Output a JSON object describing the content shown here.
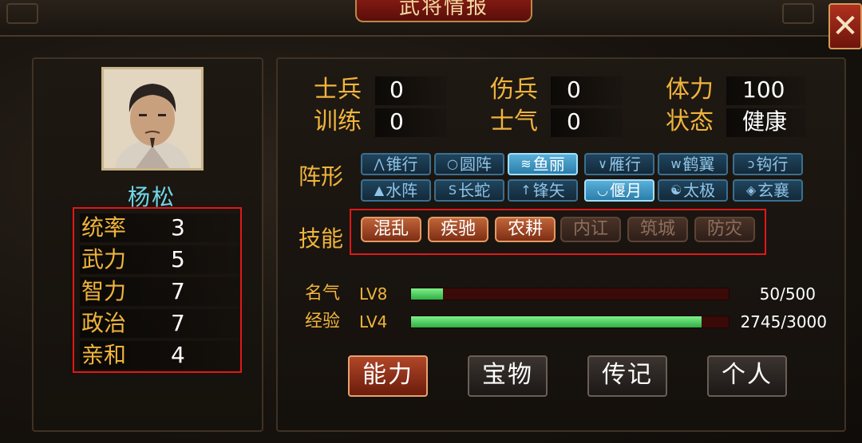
{
  "window": {
    "title": "武将情报",
    "close_glyph": "✕"
  },
  "general": {
    "name": "杨松"
  },
  "attributes": [
    {
      "label": "统率",
      "value": "3"
    },
    {
      "label": "武力",
      "value": "5"
    },
    {
      "label": "智力",
      "value": "7"
    },
    {
      "label": "政治",
      "value": "7"
    },
    {
      "label": "亲和",
      "value": "4"
    }
  ],
  "troops": {
    "soldiers_label": "士兵",
    "soldiers": "0",
    "wounded_label": "伤兵",
    "wounded": "0",
    "stamina_label": "体力",
    "stamina": "100",
    "training_label": "训练",
    "training": "0",
    "morale_label": "士气",
    "morale": "0",
    "status_label": "状态",
    "status": "健康"
  },
  "formation": {
    "label": "阵形",
    "items": [
      {
        "icon": "⋀",
        "label": "锥行",
        "active": false
      },
      {
        "icon": "○",
        "label": "圆阵",
        "active": false
      },
      {
        "icon": "≋",
        "label": "鱼丽",
        "active": true
      },
      {
        "icon": "∨",
        "label": "雁行",
        "active": false
      },
      {
        "icon": "w",
        "label": "鹤翼",
        "active": false
      },
      {
        "icon": "ↄ",
        "label": "钩行",
        "active": false
      },
      {
        "icon": "▲",
        "label": "水阵",
        "active": false
      },
      {
        "icon": "S",
        "label": "长蛇",
        "active": false
      },
      {
        "icon": "↑",
        "label": "锋矢",
        "active": false
      },
      {
        "icon": "◡",
        "label": "偃月",
        "active": true
      },
      {
        "icon": "☯",
        "label": "太极",
        "active": false
      },
      {
        "icon": "◈",
        "label": "玄襄",
        "active": false
      }
    ]
  },
  "skills": {
    "label": "技能",
    "items": [
      {
        "label": "混乱",
        "learned": true
      },
      {
        "label": "疾驰",
        "learned": true
      },
      {
        "label": "农耕",
        "learned": true
      },
      {
        "label": "内讧",
        "learned": false
      },
      {
        "label": "筑城",
        "learned": false
      },
      {
        "label": "防灾",
        "learned": false
      }
    ]
  },
  "fame": {
    "label": "名气",
    "level": "LV8",
    "text": "50/500",
    "fraction": 0.1
  },
  "experience": {
    "label": "经验",
    "level": "LV4",
    "text": "2745/3000",
    "fraction": 0.915
  },
  "tabs": [
    {
      "label": "能力",
      "active": true
    },
    {
      "label": "宝物",
      "active": false
    },
    {
      "label": "传记",
      "active": false
    },
    {
      "label": "个人",
      "active": false
    }
  ],
  "colors": {
    "accent_gold": "#f0b43c",
    "name_cyan": "#6fd6e8",
    "highlight_red": "#e01818",
    "bar_green": "#2fb044"
  }
}
